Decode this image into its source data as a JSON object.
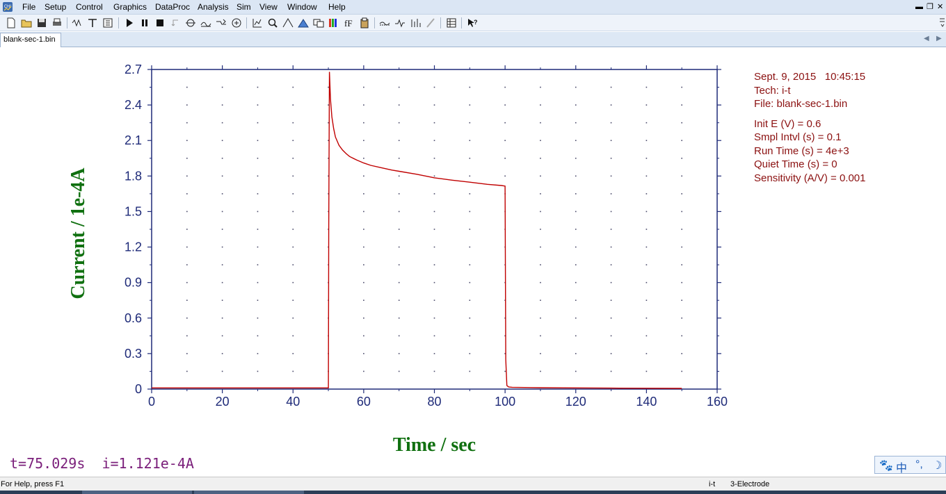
{
  "app": {
    "menus": [
      "File",
      "Setup",
      "Control",
      "Graphics",
      "DataProc",
      "Analysis",
      "Sim",
      "View",
      "Window",
      "Help"
    ],
    "window_controls": [
      "▬",
      "❐",
      "✕"
    ]
  },
  "toolbar": {
    "icons": [
      "new-file-icon",
      "open-folder-icon",
      "save-icon",
      "print-icon",
      "technique-icon",
      "text-tool-icon",
      "parameters-icon",
      "run-icon",
      "pause-icon",
      "stop-icon",
      "reverse-icon",
      "zero-icon",
      "filter-icon",
      "smooth-icon",
      "cell-icon",
      "graph-icon",
      "zoom-icon",
      "peak-icon",
      "integrate-icon",
      "overlay-icon",
      "color-icon",
      "font-icon",
      "clipboard-icon",
      "baseline-icon",
      "derivative-icon",
      "data-list-icon",
      "help-pointer-icon"
    ]
  },
  "tab": {
    "filename": "blank-sec-1.bin"
  },
  "info": {
    "date_time": "Sept. 9, 2015   10:45:15",
    "tech": "Tech: i-t",
    "file": "File: blank-sec-1.bin",
    "init_e": "Init E (V) = 0.6",
    "smpl_intvl": "Smpl Intvl (s) = 0.1",
    "run_time": "Run Time (s) = 4e+3",
    "quiet_time": "Quiet Time (s) = 0",
    "sensitivity": "Sensitivity (A/V) = 0.001"
  },
  "cursor": {
    "readout": "t=75.029s  i=1.121e-4A"
  },
  "ime": {
    "items": [
      "🐾",
      "中",
      "°,",
      "☽"
    ]
  },
  "status": {
    "help": "For Help, press F1",
    "technique": "i-t",
    "electrode": "3-Electrode"
  },
  "chart_data": {
    "type": "line",
    "xlabel": "Time / sec",
    "ylabel": "Current / 1e-4A",
    "xlim": [
      0,
      160
    ],
    "ylim": [
      0,
      2.7
    ],
    "xticks": [
      0,
      20,
      40,
      60,
      80,
      100,
      120,
      140,
      160
    ],
    "yticks": [
      0,
      0.3,
      0.6,
      0.9,
      1.2,
      1.5,
      1.8,
      2.1,
      2.4,
      2.7
    ],
    "ytick_labels": [
      "0",
      "0.3",
      "0.6",
      "0.9",
      "1.2",
      "1.5",
      "1.8",
      "2.1",
      "2.4",
      "2.7"
    ],
    "grid": "dotted",
    "series": [
      {
        "color": "#c00000",
        "x": [
          0,
          10,
          20,
          30,
          40,
          50,
          50.1,
          50.3,
          50.6,
          51,
          51.5,
          52,
          53,
          54,
          55,
          56,
          58,
          60,
          62,
          65,
          68,
          70,
          75,
          80,
          85,
          90,
          95,
          99,
          100,
          100.2,
          100.5,
          101,
          102,
          110,
          120,
          130,
          140,
          150
        ],
        "y": [
          0.01,
          0.01,
          0.01,
          0.01,
          0.01,
          0.01,
          1.35,
          2.68,
          2.45,
          2.3,
          2.2,
          2.13,
          2.06,
          2.02,
          1.99,
          1.965,
          1.935,
          1.91,
          1.89,
          1.87,
          1.85,
          1.84,
          1.815,
          1.785,
          1.765,
          1.748,
          1.73,
          1.72,
          1.715,
          0.25,
          0.03,
          0.018,
          0.015,
          0.012,
          0.01,
          0.008,
          0.007,
          0.006
        ]
      }
    ]
  },
  "colors": {
    "axis": "#1e2a78",
    "label": "#107010",
    "trace": "#c00000",
    "info": "#8b1010",
    "readout": "#7a1e7a"
  }
}
